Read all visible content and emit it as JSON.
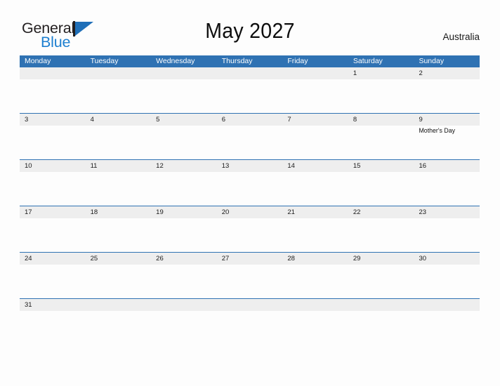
{
  "brand": {
    "word_one": "General",
    "word_two": "Blue"
  },
  "header": {
    "title": "May 2027",
    "region": "Australia"
  },
  "colors": {
    "header_blue": "#2f72b3",
    "row_divider_blue": "#2f72b3",
    "date_band_gray": "#eeeeee",
    "logo_blue": "#1d7fd0",
    "page_background": "#fdfdfd",
    "text_dark": "#1a1a1a"
  },
  "calendar": {
    "weekdays": [
      "Monday",
      "Tuesday",
      "Wednesday",
      "Thursday",
      "Friday",
      "Saturday",
      "Sunday"
    ],
    "weeks": [
      [
        {
          "date": "",
          "event": ""
        },
        {
          "date": "",
          "event": ""
        },
        {
          "date": "",
          "event": ""
        },
        {
          "date": "",
          "event": ""
        },
        {
          "date": "",
          "event": ""
        },
        {
          "date": "1",
          "event": ""
        },
        {
          "date": "2",
          "event": ""
        }
      ],
      [
        {
          "date": "3",
          "event": ""
        },
        {
          "date": "4",
          "event": ""
        },
        {
          "date": "5",
          "event": ""
        },
        {
          "date": "6",
          "event": ""
        },
        {
          "date": "7",
          "event": ""
        },
        {
          "date": "8",
          "event": ""
        },
        {
          "date": "9",
          "event": "Mother's Day"
        }
      ],
      [
        {
          "date": "10",
          "event": ""
        },
        {
          "date": "11",
          "event": ""
        },
        {
          "date": "12",
          "event": ""
        },
        {
          "date": "13",
          "event": ""
        },
        {
          "date": "14",
          "event": ""
        },
        {
          "date": "15",
          "event": ""
        },
        {
          "date": "16",
          "event": ""
        }
      ],
      [
        {
          "date": "17",
          "event": ""
        },
        {
          "date": "18",
          "event": ""
        },
        {
          "date": "19",
          "event": ""
        },
        {
          "date": "20",
          "event": ""
        },
        {
          "date": "21",
          "event": ""
        },
        {
          "date": "22",
          "event": ""
        },
        {
          "date": "23",
          "event": ""
        }
      ],
      [
        {
          "date": "24",
          "event": ""
        },
        {
          "date": "25",
          "event": ""
        },
        {
          "date": "26",
          "event": ""
        },
        {
          "date": "27",
          "event": ""
        },
        {
          "date": "28",
          "event": ""
        },
        {
          "date": "29",
          "event": ""
        },
        {
          "date": "30",
          "event": ""
        }
      ],
      [
        {
          "date": "31",
          "event": ""
        },
        {
          "date": "",
          "event": ""
        },
        {
          "date": "",
          "event": ""
        },
        {
          "date": "",
          "event": ""
        },
        {
          "date": "",
          "event": ""
        },
        {
          "date": "",
          "event": ""
        },
        {
          "date": "",
          "event": ""
        }
      ]
    ]
  }
}
